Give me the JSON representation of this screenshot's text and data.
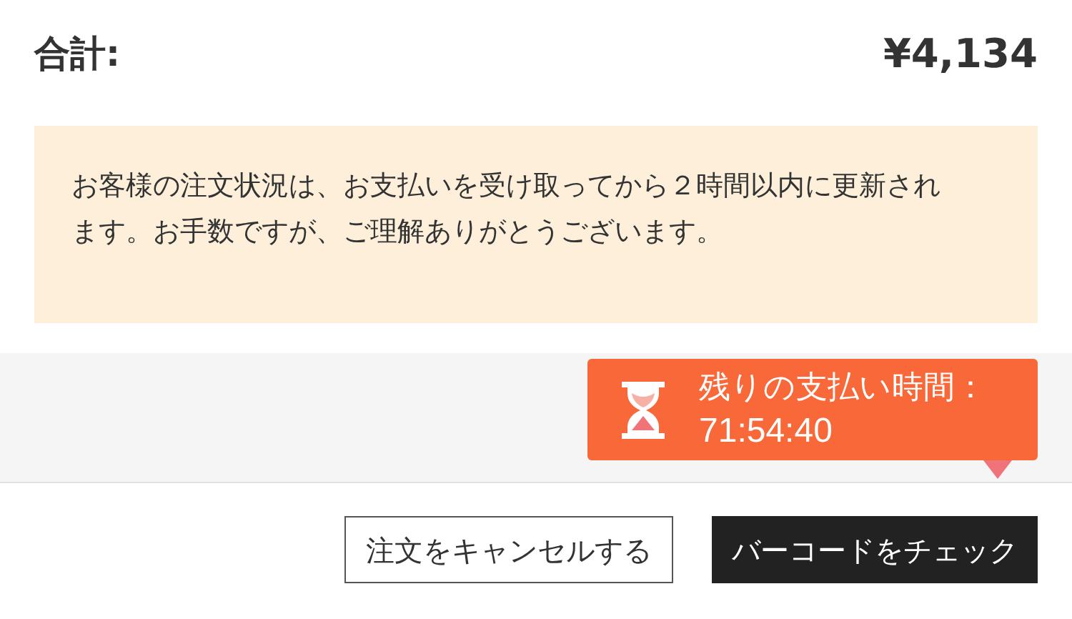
{
  "total": {
    "label": "合計:",
    "amount": "¥4,134"
  },
  "notice": "お客様の注文状況は、お支払いを受け取ってから２時間以内に更新されます。お手数ですが、ご理解ありがとうございます。",
  "timer": {
    "label": "残りの支払い時間：",
    "time": "71:54:40"
  },
  "buttons": [
    {
      "label": "注文をキャンセルする",
      "kind": "outline"
    },
    {
      "label": "バーコードをチェック",
      "kind": "primary"
    }
  ]
}
